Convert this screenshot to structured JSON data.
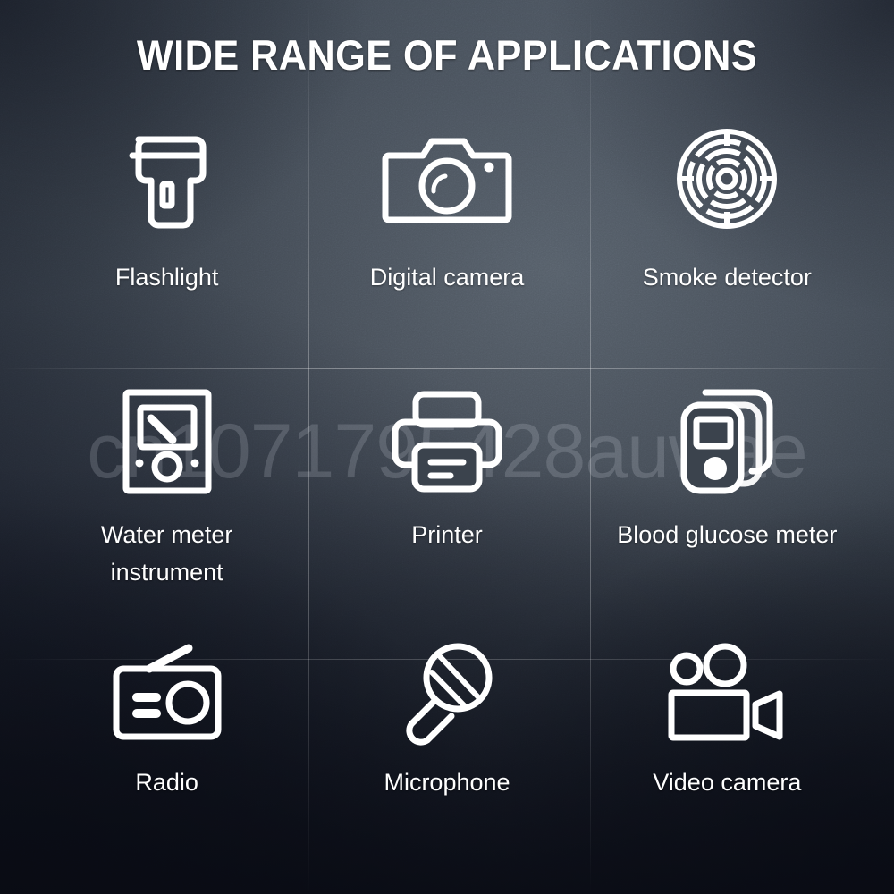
{
  "page": {
    "title": "WIDE RANGE OF APPLICATIONS",
    "watermark": "cn1071795428auwae",
    "background_top_color": "#4a525c",
    "background_bottom_color": "#141826",
    "text_color": "#ffffff",
    "icon_color": "#ffffff"
  },
  "items": [
    {
      "label": "Flashlight",
      "icon": "flashlight-icon"
    },
    {
      "label": "Digital camera",
      "icon": "camera-icon"
    },
    {
      "label": "Smoke detector",
      "icon": "smoke-detector-icon"
    },
    {
      "label": "Water meter instrument",
      "icon": "water-meter-icon"
    },
    {
      "label": "Printer",
      "icon": "printer-icon"
    },
    {
      "label": "Blood glucose meter",
      "icon": "glucose-meter-icon"
    },
    {
      "label": "Radio",
      "icon": "radio-icon"
    },
    {
      "label": "Microphone",
      "icon": "microphone-icon"
    },
    {
      "label": "Video camera",
      "icon": "video-camera-icon"
    }
  ]
}
